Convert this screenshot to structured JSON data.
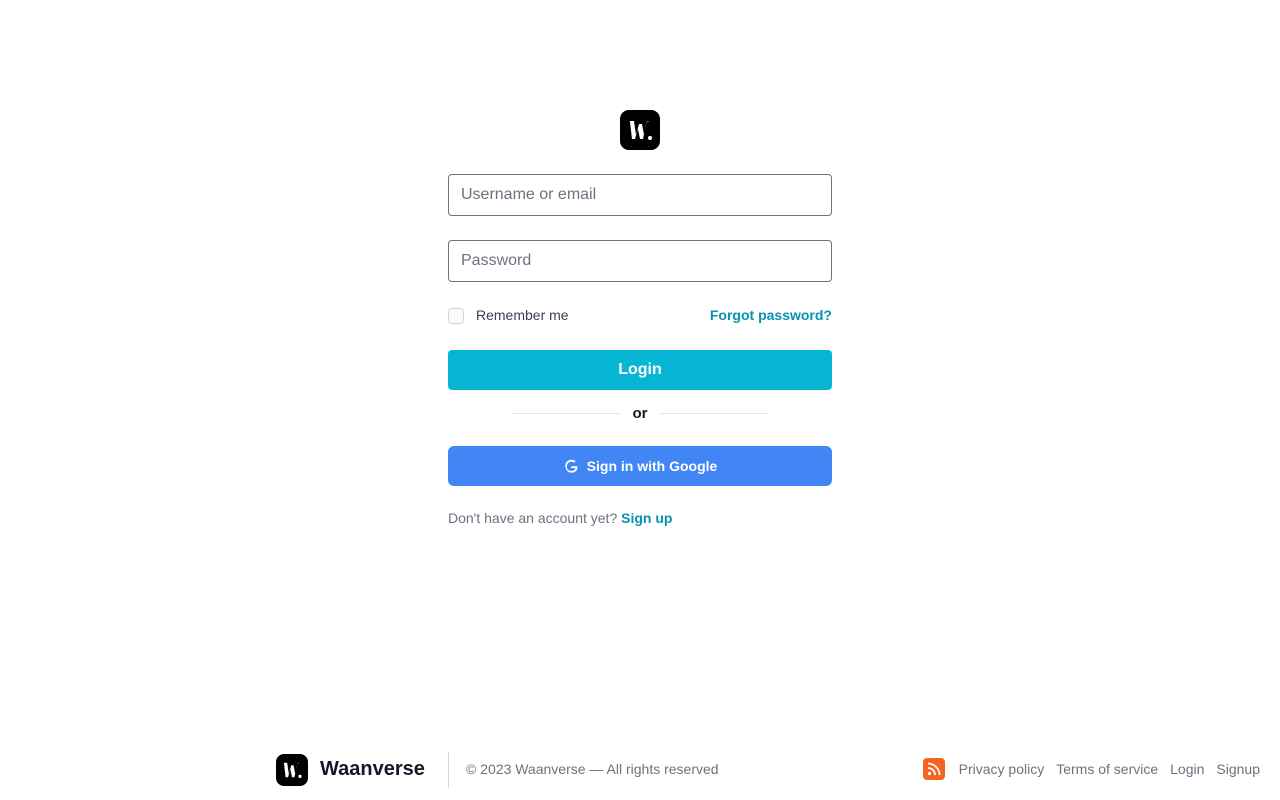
{
  "app": {
    "logo_letter": "W."
  },
  "form": {
    "username_placeholder": "Username or email",
    "password_placeholder": "Password",
    "remember_label": "Remember me",
    "forgot_label": "Forgot password?",
    "login_label": "Login",
    "or_label": "or",
    "google_label": "Sign in with Google",
    "signup_prompt": "Don't have an account yet?",
    "signup_link": "Sign up"
  },
  "footer": {
    "brand": "Waanverse",
    "copyright": "© 2023 Waanverse — All rights reserved",
    "links": [
      "Privacy policy",
      "Terms of service",
      "Login",
      "Signup"
    ],
    "rss_icon": "rss-icon"
  },
  "colors": {
    "accent": "#06b6d4",
    "link": "#0891b2",
    "google": "#4285f4",
    "rss": "#f26522"
  }
}
